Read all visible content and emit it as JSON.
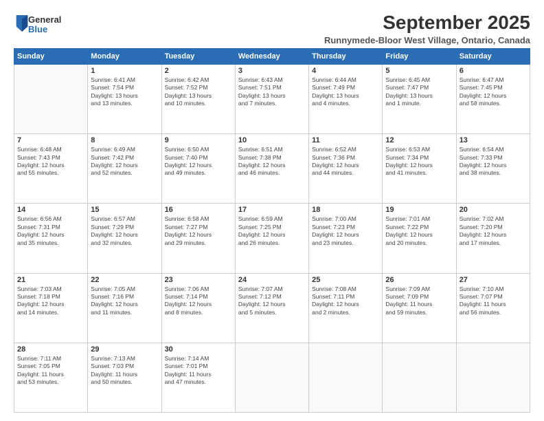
{
  "logo": {
    "general": "General",
    "blue": "Blue"
  },
  "title": "September 2025",
  "location": "Runnymede-Bloor West Village, Ontario, Canada",
  "days_of_week": [
    "Sunday",
    "Monday",
    "Tuesday",
    "Wednesday",
    "Thursday",
    "Friday",
    "Saturday"
  ],
  "weeks": [
    [
      {
        "day": "",
        "info": ""
      },
      {
        "day": "1",
        "info": "Sunrise: 6:41 AM\nSunset: 7:54 PM\nDaylight: 13 hours\nand 13 minutes."
      },
      {
        "day": "2",
        "info": "Sunrise: 6:42 AM\nSunset: 7:52 PM\nDaylight: 13 hours\nand 10 minutes."
      },
      {
        "day": "3",
        "info": "Sunrise: 6:43 AM\nSunset: 7:51 PM\nDaylight: 13 hours\nand 7 minutes."
      },
      {
        "day": "4",
        "info": "Sunrise: 6:44 AM\nSunset: 7:49 PM\nDaylight: 13 hours\nand 4 minutes."
      },
      {
        "day": "5",
        "info": "Sunrise: 6:45 AM\nSunset: 7:47 PM\nDaylight: 13 hours\nand 1 minute."
      },
      {
        "day": "6",
        "info": "Sunrise: 6:47 AM\nSunset: 7:45 PM\nDaylight: 12 hours\nand 58 minutes."
      }
    ],
    [
      {
        "day": "7",
        "info": "Sunrise: 6:48 AM\nSunset: 7:43 PM\nDaylight: 12 hours\nand 55 minutes."
      },
      {
        "day": "8",
        "info": "Sunrise: 6:49 AM\nSunset: 7:42 PM\nDaylight: 12 hours\nand 52 minutes."
      },
      {
        "day": "9",
        "info": "Sunrise: 6:50 AM\nSunset: 7:40 PM\nDaylight: 12 hours\nand 49 minutes."
      },
      {
        "day": "10",
        "info": "Sunrise: 6:51 AM\nSunset: 7:38 PM\nDaylight: 12 hours\nand 46 minutes."
      },
      {
        "day": "11",
        "info": "Sunrise: 6:52 AM\nSunset: 7:36 PM\nDaylight: 12 hours\nand 44 minutes."
      },
      {
        "day": "12",
        "info": "Sunrise: 6:53 AM\nSunset: 7:34 PM\nDaylight: 12 hours\nand 41 minutes."
      },
      {
        "day": "13",
        "info": "Sunrise: 6:54 AM\nSunset: 7:33 PM\nDaylight: 12 hours\nand 38 minutes."
      }
    ],
    [
      {
        "day": "14",
        "info": "Sunrise: 6:56 AM\nSunset: 7:31 PM\nDaylight: 12 hours\nand 35 minutes."
      },
      {
        "day": "15",
        "info": "Sunrise: 6:57 AM\nSunset: 7:29 PM\nDaylight: 12 hours\nand 32 minutes."
      },
      {
        "day": "16",
        "info": "Sunrise: 6:58 AM\nSunset: 7:27 PM\nDaylight: 12 hours\nand 29 minutes."
      },
      {
        "day": "17",
        "info": "Sunrise: 6:59 AM\nSunset: 7:25 PM\nDaylight: 12 hours\nand 26 minutes."
      },
      {
        "day": "18",
        "info": "Sunrise: 7:00 AM\nSunset: 7:23 PM\nDaylight: 12 hours\nand 23 minutes."
      },
      {
        "day": "19",
        "info": "Sunrise: 7:01 AM\nSunset: 7:22 PM\nDaylight: 12 hours\nand 20 minutes."
      },
      {
        "day": "20",
        "info": "Sunrise: 7:02 AM\nSunset: 7:20 PM\nDaylight: 12 hours\nand 17 minutes."
      }
    ],
    [
      {
        "day": "21",
        "info": "Sunrise: 7:03 AM\nSunset: 7:18 PM\nDaylight: 12 hours\nand 14 minutes."
      },
      {
        "day": "22",
        "info": "Sunrise: 7:05 AM\nSunset: 7:16 PM\nDaylight: 12 hours\nand 11 minutes."
      },
      {
        "day": "23",
        "info": "Sunrise: 7:06 AM\nSunset: 7:14 PM\nDaylight: 12 hours\nand 8 minutes."
      },
      {
        "day": "24",
        "info": "Sunrise: 7:07 AM\nSunset: 7:12 PM\nDaylight: 12 hours\nand 5 minutes."
      },
      {
        "day": "25",
        "info": "Sunrise: 7:08 AM\nSunset: 7:11 PM\nDaylight: 12 hours\nand 2 minutes."
      },
      {
        "day": "26",
        "info": "Sunrise: 7:09 AM\nSunset: 7:09 PM\nDaylight: 11 hours\nand 59 minutes."
      },
      {
        "day": "27",
        "info": "Sunrise: 7:10 AM\nSunset: 7:07 PM\nDaylight: 11 hours\nand 56 minutes."
      }
    ],
    [
      {
        "day": "28",
        "info": "Sunrise: 7:11 AM\nSunset: 7:05 PM\nDaylight: 11 hours\nand 53 minutes."
      },
      {
        "day": "29",
        "info": "Sunrise: 7:13 AM\nSunset: 7:03 PM\nDaylight: 11 hours\nand 50 minutes."
      },
      {
        "day": "30",
        "info": "Sunrise: 7:14 AM\nSunset: 7:01 PM\nDaylight: 11 hours\nand 47 minutes."
      },
      {
        "day": "",
        "info": ""
      },
      {
        "day": "",
        "info": ""
      },
      {
        "day": "",
        "info": ""
      },
      {
        "day": "",
        "info": ""
      }
    ]
  ]
}
